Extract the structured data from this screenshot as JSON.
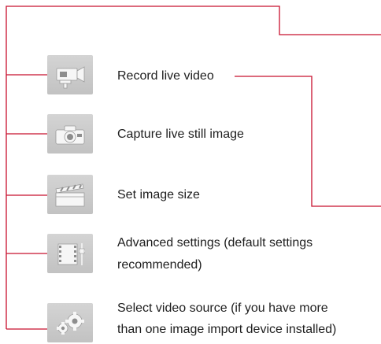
{
  "items": [
    {
      "id": "record",
      "icon": "video-camera-icon",
      "label": "Record live video"
    },
    {
      "id": "capture",
      "icon": "still-camera-icon",
      "label": "Capture live still image"
    },
    {
      "id": "size",
      "icon": "clapperboard-icon",
      "label": "Set image size"
    },
    {
      "id": "advanced",
      "icon": "film-settings-icon",
      "label_line1": "Advanced settings (default settings",
      "label_line2": "recommended)"
    },
    {
      "id": "source",
      "icon": "gears-icon",
      "label_line1": "Select video source (if you have more",
      "label_line2": "than one image import device installed)"
    }
  ],
  "colors": {
    "callout_line": "#c8102e",
    "icon_background": "#c8c8c8",
    "icon_glyph": "#f4f4f4"
  }
}
